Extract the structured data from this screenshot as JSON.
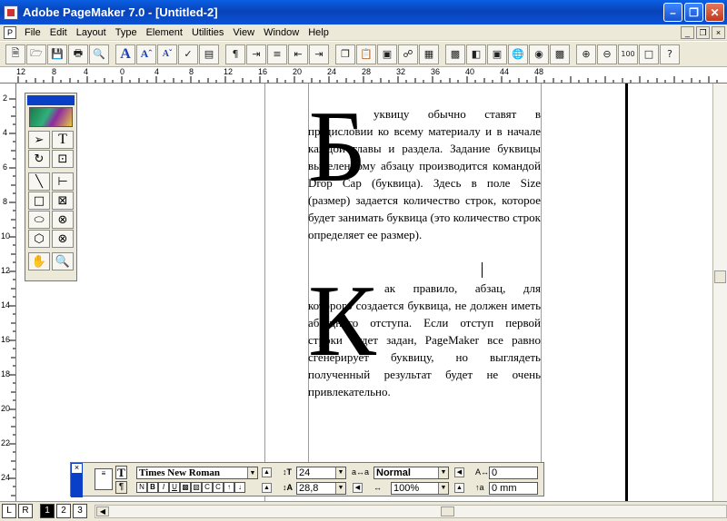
{
  "window": {
    "title": "Adobe PageMaker 7.0 - [Untitled-2]"
  },
  "menu": [
    "File",
    "Edit",
    "Layout",
    "Type",
    "Element",
    "Utilities",
    "View",
    "Window",
    "Help"
  ],
  "hruler": [
    "12",
    "8",
    "4",
    "0",
    "4",
    "8",
    "12",
    "16",
    "20",
    "24",
    "28",
    "32",
    "36",
    "40",
    "44",
    "48"
  ],
  "vruler": [
    "2",
    "4",
    "6",
    "8",
    "10",
    "12",
    "14",
    "16",
    "18",
    "20",
    "22",
    "24"
  ],
  "text": {
    "cap1": "Б",
    "para1": "уквицу обычно ставят в предисловии ко всему материалу и в начале каждой главы и раздела. Задание буквицы выделенному абзацу производится командой Drop Cap (буквица). Здесь в поле Size (размер) задается количество строк, которое будет занимать буквица (это количество строк определяет ее размер).",
    "cap2": "К",
    "para2": "ак правило, абзац, для которого создается буквица, не должен иметь абзацного отступа. Если отступ первой строки будет задан, PageMaker все равно сгенерирует буквицу, но выглядеть полученный результат будет не очень привлекательно."
  },
  "control": {
    "font": "Times New Roman",
    "size": "24",
    "leading": "28,8",
    "style": "Normal",
    "width": "100%",
    "kern": "0",
    "shift": "0 mm",
    "style_buttons": [
      "N",
      "B",
      "I",
      "U",
      "",
      "",
      "C",
      "C"
    ]
  },
  "pages": {
    "left": "L",
    "right": "R",
    "items": [
      "1",
      "2",
      "3"
    ],
    "active": "1"
  },
  "colors": {
    "titlebar": "#0a52d8",
    "panel": "#ece9d8",
    "frame": "#8d96e0"
  }
}
